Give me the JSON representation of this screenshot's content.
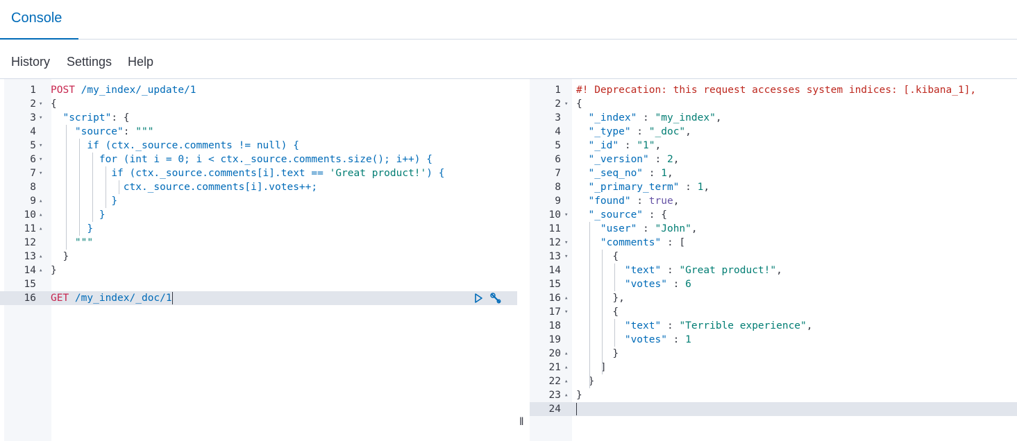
{
  "tabs": {
    "console": "Console"
  },
  "menu": {
    "history": "History",
    "settings": "Settings",
    "help": "Help"
  },
  "resizer": "‖",
  "request": {
    "lines": [
      {
        "n": "1",
        "fold": "",
        "tokens": [
          {
            "c": "t-method",
            "t": "POST"
          },
          {
            "c": "t-url",
            "t": " /my_index/_update/1"
          }
        ]
      },
      {
        "n": "2",
        "fold": "▾",
        "tokens": [
          {
            "c": "t-punc",
            "t": "{"
          }
        ]
      },
      {
        "n": "3",
        "fold": "▾",
        "tokens": [
          {
            "c": "t-punc",
            "t": "  "
          },
          {
            "c": "t-key",
            "t": "\"script\""
          },
          {
            "c": "t-punc",
            "t": ": {"
          }
        ]
      },
      {
        "n": "4",
        "fold": "",
        "tokens": [
          {
            "c": "t-punc",
            "t": "    "
          },
          {
            "c": "t-key",
            "t": "\"source\""
          },
          {
            "c": "t-punc",
            "t": ": "
          },
          {
            "c": "t-str",
            "t": "\"\"\""
          }
        ]
      },
      {
        "n": "5",
        "fold": "▾",
        "tokens": [
          {
            "c": "t-punc",
            "t": "      "
          },
          {
            "c": "t-kw",
            "t": "if (ctx._source.comments != null) {"
          }
        ]
      },
      {
        "n": "6",
        "fold": "▾",
        "tokens": [
          {
            "c": "t-punc",
            "t": "        "
          },
          {
            "c": "t-kw",
            "t": "for (int i = 0; i < ctx._source.comments.size(); i++) {"
          }
        ]
      },
      {
        "n": "7",
        "fold": "▾",
        "tokens": [
          {
            "c": "t-punc",
            "t": "          "
          },
          {
            "c": "t-kw",
            "t": "if (ctx._source.comments[i].text == "
          },
          {
            "c": "t-green",
            "t": "'Great product!'"
          },
          {
            "c": "t-kw",
            "t": ") {"
          }
        ]
      },
      {
        "n": "8",
        "fold": "",
        "tokens": [
          {
            "c": "t-punc",
            "t": "            "
          },
          {
            "c": "t-kw",
            "t": "ctx._source.comments[i].votes++;"
          }
        ]
      },
      {
        "n": "9",
        "fold": "▴",
        "tokens": [
          {
            "c": "t-punc",
            "t": "          "
          },
          {
            "c": "t-kw",
            "t": "}"
          }
        ]
      },
      {
        "n": "10",
        "fold": "▴",
        "tokens": [
          {
            "c": "t-punc",
            "t": "        "
          },
          {
            "c": "t-kw",
            "t": "}"
          }
        ]
      },
      {
        "n": "11",
        "fold": "▴",
        "tokens": [
          {
            "c": "t-punc",
            "t": "      "
          },
          {
            "c": "t-kw",
            "t": "}"
          }
        ]
      },
      {
        "n": "12",
        "fold": "",
        "tokens": [
          {
            "c": "t-punc",
            "t": "    "
          },
          {
            "c": "t-str",
            "t": "\"\"\""
          }
        ]
      },
      {
        "n": "13",
        "fold": "▴",
        "tokens": [
          {
            "c": "t-punc",
            "t": "  }"
          }
        ]
      },
      {
        "n": "14",
        "fold": "▴",
        "tokens": [
          {
            "c": "t-punc",
            "t": "}"
          }
        ]
      },
      {
        "n": "15",
        "fold": "",
        "tokens": []
      },
      {
        "n": "16",
        "fold": "",
        "tokens": [
          {
            "c": "t-method",
            "t": "GET"
          },
          {
            "c": "t-url",
            "t": " /my_index/_doc/1"
          }
        ]
      }
    ]
  },
  "response": {
    "lines": [
      {
        "n": "1",
        "fold": "",
        "tokens": [
          {
            "c": "t-warn",
            "t": "#! Deprecation: this request accesses system indices: [.kibana_1],"
          }
        ]
      },
      {
        "n": "2",
        "fold": "▾",
        "tokens": [
          {
            "c": "t-punc",
            "t": "{"
          }
        ]
      },
      {
        "n": "3",
        "fold": "",
        "tokens": [
          {
            "c": "t-punc",
            "t": "  "
          },
          {
            "c": "t-key",
            "t": "\"_index\""
          },
          {
            "c": "t-punc",
            "t": " : "
          },
          {
            "c": "t-str",
            "t": "\"my_index\""
          },
          {
            "c": "t-punc",
            "t": ","
          }
        ]
      },
      {
        "n": "4",
        "fold": "",
        "tokens": [
          {
            "c": "t-punc",
            "t": "  "
          },
          {
            "c": "t-key",
            "t": "\"_type\""
          },
          {
            "c": "t-punc",
            "t": " : "
          },
          {
            "c": "t-str",
            "t": "\"_doc\""
          },
          {
            "c": "t-punc",
            "t": ","
          }
        ]
      },
      {
        "n": "5",
        "fold": "",
        "tokens": [
          {
            "c": "t-punc",
            "t": "  "
          },
          {
            "c": "t-key",
            "t": "\"_id\""
          },
          {
            "c": "t-punc",
            "t": " : "
          },
          {
            "c": "t-str",
            "t": "\"1\""
          },
          {
            "c": "t-punc",
            "t": ","
          }
        ]
      },
      {
        "n": "6",
        "fold": "",
        "tokens": [
          {
            "c": "t-punc",
            "t": "  "
          },
          {
            "c": "t-key",
            "t": "\"_version\""
          },
          {
            "c": "t-punc",
            "t": " : "
          },
          {
            "c": "t-num",
            "t": "2"
          },
          {
            "c": "t-punc",
            "t": ","
          }
        ]
      },
      {
        "n": "7",
        "fold": "",
        "tokens": [
          {
            "c": "t-punc",
            "t": "  "
          },
          {
            "c": "t-key",
            "t": "\"_seq_no\""
          },
          {
            "c": "t-punc",
            "t": " : "
          },
          {
            "c": "t-num",
            "t": "1"
          },
          {
            "c": "t-punc",
            "t": ","
          }
        ]
      },
      {
        "n": "8",
        "fold": "",
        "tokens": [
          {
            "c": "t-punc",
            "t": "  "
          },
          {
            "c": "t-key",
            "t": "\"_primary_term\""
          },
          {
            "c": "t-punc",
            "t": " : "
          },
          {
            "c": "t-num",
            "t": "1"
          },
          {
            "c": "t-punc",
            "t": ","
          }
        ]
      },
      {
        "n": "9",
        "fold": "",
        "tokens": [
          {
            "c": "t-punc",
            "t": "  "
          },
          {
            "c": "t-key",
            "t": "\"found\""
          },
          {
            "c": "t-punc",
            "t": " : "
          },
          {
            "c": "t-bool",
            "t": "true"
          },
          {
            "c": "t-punc",
            "t": ","
          }
        ]
      },
      {
        "n": "10",
        "fold": "▾",
        "tokens": [
          {
            "c": "t-punc",
            "t": "  "
          },
          {
            "c": "t-key",
            "t": "\"_source\""
          },
          {
            "c": "t-punc",
            "t": " : {"
          }
        ]
      },
      {
        "n": "11",
        "fold": "",
        "tokens": [
          {
            "c": "t-punc",
            "t": "    "
          },
          {
            "c": "t-key",
            "t": "\"user\""
          },
          {
            "c": "t-punc",
            "t": " : "
          },
          {
            "c": "t-str",
            "t": "\"John\""
          },
          {
            "c": "t-punc",
            "t": ","
          }
        ]
      },
      {
        "n": "12",
        "fold": "▾",
        "tokens": [
          {
            "c": "t-punc",
            "t": "    "
          },
          {
            "c": "t-key",
            "t": "\"comments\""
          },
          {
            "c": "t-punc",
            "t": " : ["
          }
        ]
      },
      {
        "n": "13",
        "fold": "▾",
        "tokens": [
          {
            "c": "t-punc",
            "t": "      {"
          }
        ]
      },
      {
        "n": "14",
        "fold": "",
        "tokens": [
          {
            "c": "t-punc",
            "t": "        "
          },
          {
            "c": "t-key",
            "t": "\"text\""
          },
          {
            "c": "t-punc",
            "t": " : "
          },
          {
            "c": "t-str",
            "t": "\"Great product!\""
          },
          {
            "c": "t-punc",
            "t": ","
          }
        ]
      },
      {
        "n": "15",
        "fold": "",
        "tokens": [
          {
            "c": "t-punc",
            "t": "        "
          },
          {
            "c": "t-key",
            "t": "\"votes\""
          },
          {
            "c": "t-punc",
            "t": " : "
          },
          {
            "c": "t-num",
            "t": "6"
          }
        ]
      },
      {
        "n": "16",
        "fold": "▴",
        "tokens": [
          {
            "c": "t-punc",
            "t": "      },"
          }
        ]
      },
      {
        "n": "17",
        "fold": "▾",
        "tokens": [
          {
            "c": "t-punc",
            "t": "      {"
          }
        ]
      },
      {
        "n": "18",
        "fold": "",
        "tokens": [
          {
            "c": "t-punc",
            "t": "        "
          },
          {
            "c": "t-key",
            "t": "\"text\""
          },
          {
            "c": "t-punc",
            "t": " : "
          },
          {
            "c": "t-str",
            "t": "\"Terrible experience\""
          },
          {
            "c": "t-punc",
            "t": ","
          }
        ]
      },
      {
        "n": "19",
        "fold": "",
        "tokens": [
          {
            "c": "t-punc",
            "t": "        "
          },
          {
            "c": "t-key",
            "t": "\"votes\""
          },
          {
            "c": "t-punc",
            "t": " : "
          },
          {
            "c": "t-num",
            "t": "1"
          }
        ]
      },
      {
        "n": "20",
        "fold": "▴",
        "tokens": [
          {
            "c": "t-punc",
            "t": "      }"
          }
        ]
      },
      {
        "n": "21",
        "fold": "▴",
        "tokens": [
          {
            "c": "t-punc",
            "t": "    ]"
          }
        ]
      },
      {
        "n": "22",
        "fold": "▴",
        "tokens": [
          {
            "c": "t-punc",
            "t": "  }"
          }
        ]
      },
      {
        "n": "23",
        "fold": "▴",
        "tokens": [
          {
            "c": "t-punc",
            "t": "}"
          }
        ]
      },
      {
        "n": "24",
        "fold": "",
        "tokens": []
      }
    ]
  }
}
